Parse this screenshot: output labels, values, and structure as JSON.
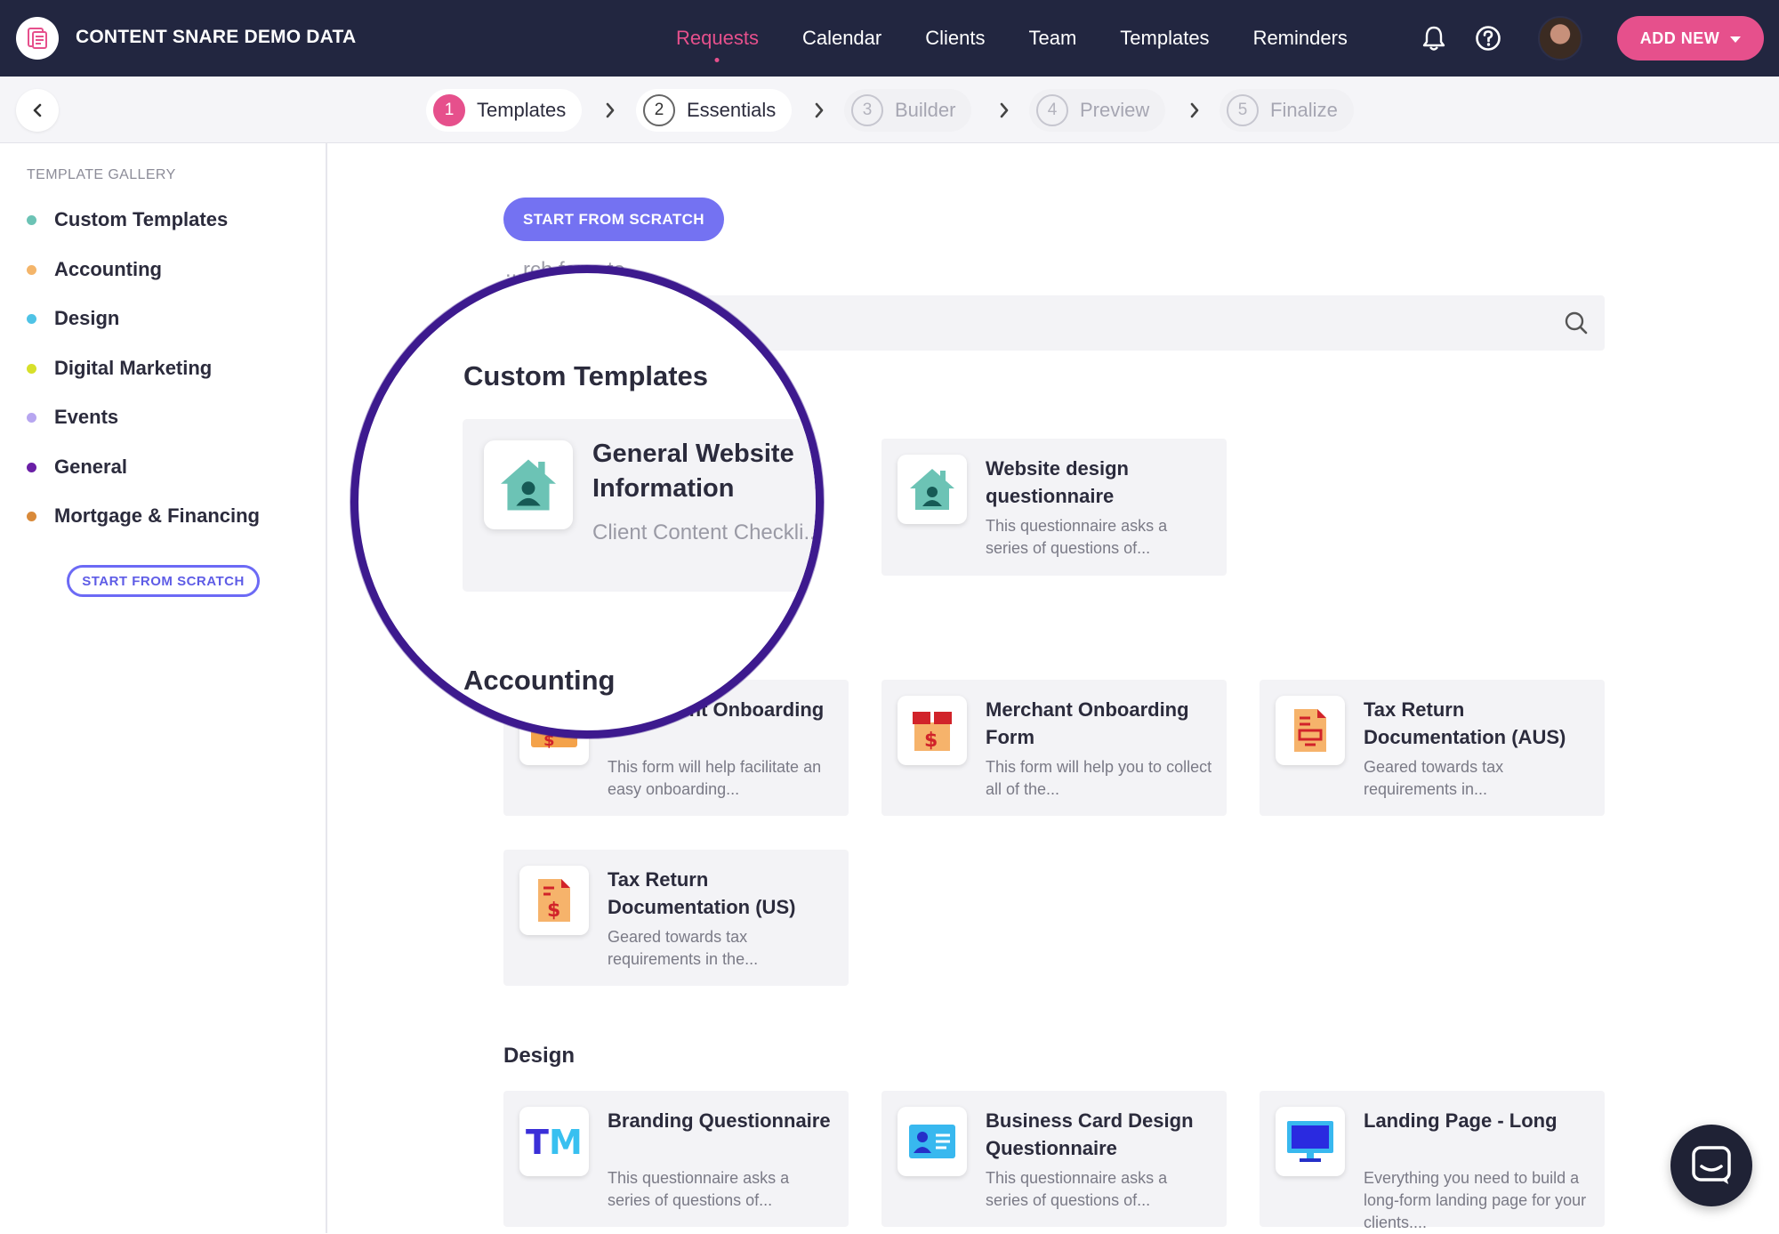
{
  "app": {
    "brand": "CONTENT SNARE DEMO DATA"
  },
  "nav": {
    "items": [
      {
        "label": "Requests",
        "active": true
      },
      {
        "label": "Calendar"
      },
      {
        "label": "Clients"
      },
      {
        "label": "Team"
      },
      {
        "label": "Templates"
      },
      {
        "label": "Reminders"
      }
    ],
    "add_new": "ADD NEW"
  },
  "steps": [
    {
      "num": "1",
      "label": "Templates",
      "state": "current"
    },
    {
      "num": "2",
      "label": "Essentials",
      "state": "done"
    },
    {
      "num": "3",
      "label": "Builder",
      "state": "todo"
    },
    {
      "num": "4",
      "label": "Preview",
      "state": "todo"
    },
    {
      "num": "5",
      "label": "Finalize",
      "state": "todo"
    }
  ],
  "sidebar": {
    "title": "TEMPLATE GALLERY",
    "items": [
      {
        "label": "Custom Templates",
        "color": "#6cc3b5"
      },
      {
        "label": "Accounting",
        "color": "#f4b56a"
      },
      {
        "label": "Design",
        "color": "#4fc3e6"
      },
      {
        "label": "Digital Marketing",
        "color": "#d7e02a"
      },
      {
        "label": "Events",
        "color": "#b7a6f0"
      },
      {
        "label": "General",
        "color": "#6a1fa6"
      },
      {
        "label": "Mortgage & Financing",
        "color": "#d98a3a"
      }
    ],
    "scratch": "START FROM SCRATCH"
  },
  "main": {
    "scratch": "START FROM SCRATCH",
    "search_label": "...rch for a te...",
    "custom": {
      "title": "Custom Templates",
      "cards": [
        {
          "title": "General Website Information",
          "desc": "Client Content Checkli... General",
          "icon": "house-user-icon"
        },
        {
          "title": "Website design questionnaire",
          "desc": "This questionnaire asks a series of questions of...",
          "icon": "house-user-icon"
        }
      ]
    },
    "accounting": {
      "title": "Accounting",
      "cards": [
        {
          "title": "...ng Client Onboarding",
          "desc": "This form will help facilitate an easy onboarding...",
          "icon": "dollar-envelope-icon"
        },
        {
          "title": "Merchant Onboarding Form",
          "desc": "This form will help you to collect all of the...",
          "icon": "dollar-box-icon"
        },
        {
          "title": "Tax Return Documentation (AUS)",
          "desc": "Geared towards tax requirements in...",
          "icon": "tax-doc-icon"
        },
        {
          "title": "Tax Return Documentation (US)",
          "desc": "Geared towards tax requirements in the...",
          "icon": "dollar-doc-icon"
        }
      ]
    },
    "design": {
      "title": "Design",
      "cards": [
        {
          "title": "Branding Questionnaire",
          "desc": "This questionnaire asks a series of questions of...",
          "icon": "tm-icon",
          "icon_text": "TM"
        },
        {
          "title": "Business Card Design Questionnaire",
          "desc": "This questionnaire asks a series of questions of...",
          "icon": "id-card-icon"
        },
        {
          "title": "Landing Page - Long",
          "desc": "Everything you need to build a long-form landing page for your clients....",
          "icon": "monitor-icon"
        }
      ]
    }
  }
}
